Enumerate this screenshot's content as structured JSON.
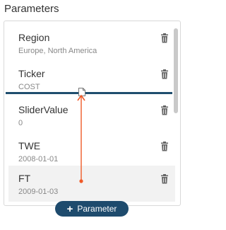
{
  "panel": {
    "title": "Parameters"
  },
  "parameters": [
    {
      "name": "Region",
      "value": "Europe, North America"
    },
    {
      "name": "Ticker",
      "value": "COST"
    },
    {
      "name": "SliderValue",
      "value": "0"
    },
    {
      "name": "TWE",
      "value": "2008-01-01"
    },
    {
      "name": "FT",
      "value": "2009-01-03"
    }
  ],
  "add_button": {
    "plus": "+",
    "label": "Parameter"
  },
  "colors": {
    "accent": "#1e4b6d",
    "drag_arrow": "#f05a28",
    "drop_indicator": "#1f4e6e"
  },
  "icons": {
    "delete": "trash-icon",
    "drag": "file-icon"
  }
}
